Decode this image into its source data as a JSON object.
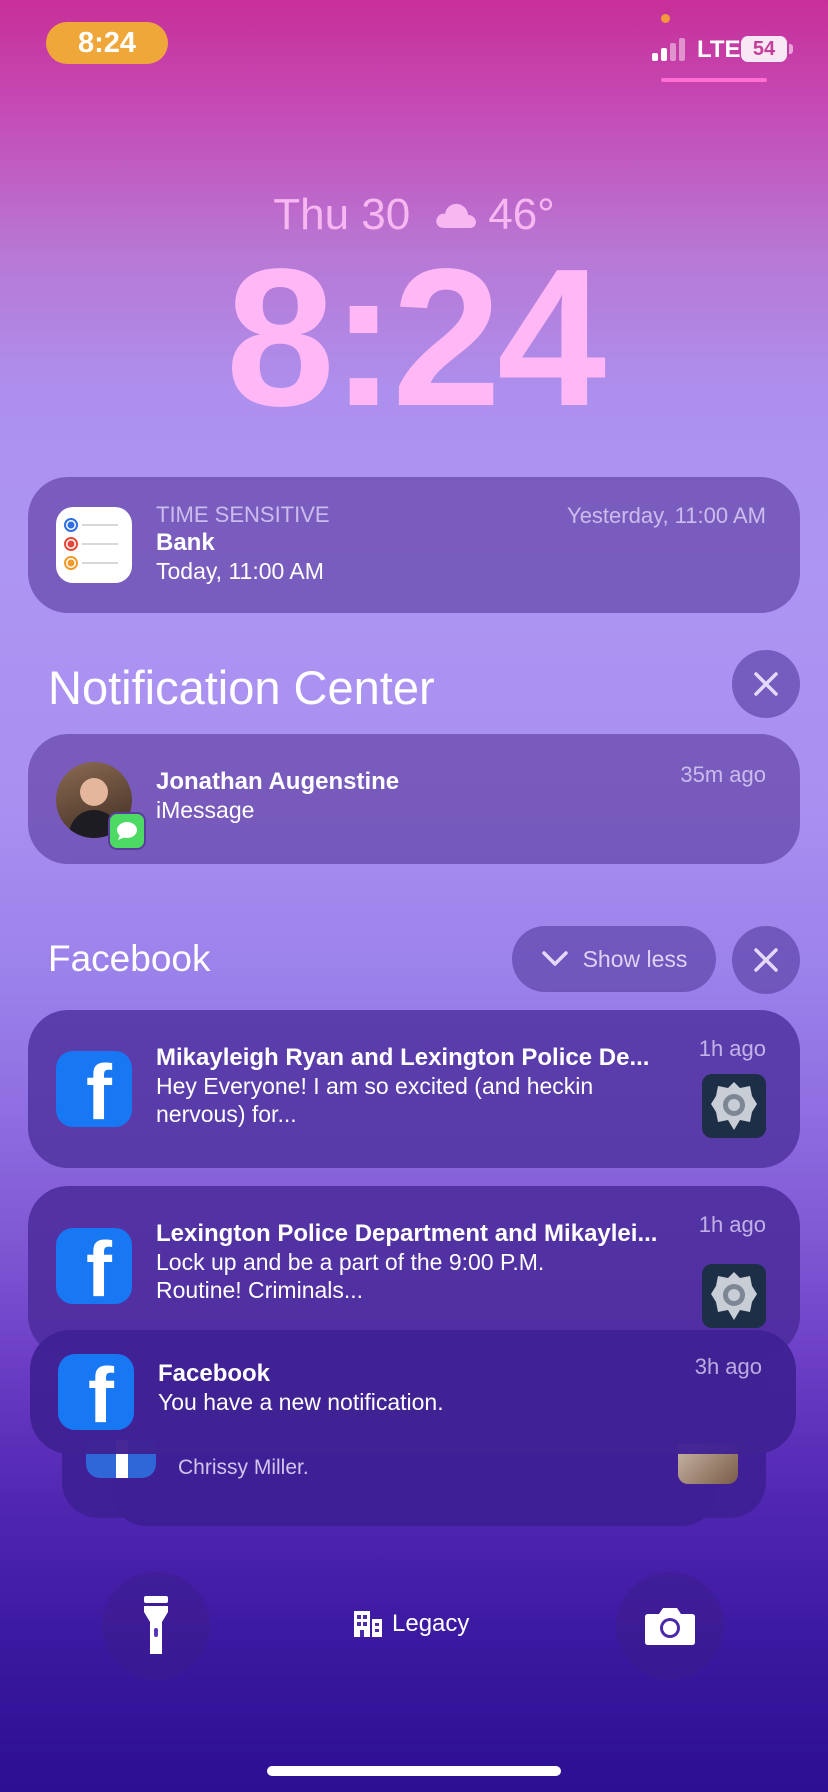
{
  "status_bar": {
    "time": "8:24",
    "carrier": "LTE",
    "battery": "54"
  },
  "lock_screen": {
    "date": "Thu 30",
    "weather_icon": "cloud-icon",
    "temperature": "46°",
    "clock": "8:24"
  },
  "time_sensitive": {
    "app_icon": "reminders-icon",
    "label": "TIME SENSITIVE",
    "title": "Bank",
    "body": "Today, 11:00 AM",
    "time": "Yesterday, 11:00 AM"
  },
  "notification_center": {
    "title": "Notification Center"
  },
  "imessage": {
    "sender": "Jonathan Augenstine",
    "app": "iMessage",
    "time": "35m ago"
  },
  "facebook_group": {
    "title": "Facebook",
    "show_less": "Show less",
    "notifications": [
      {
        "title": "Mikayleigh Ryan and Lexington Police De...",
        "body_line1": "Hey Everyone! I am so excited (and heckin",
        "body_line2": "nervous) for...",
        "time": "1h ago"
      },
      {
        "title": "Lexington Police Department and Mikaylei...",
        "body_line1": "Lock up and be a part of the 9:00 P.M.",
        "body_line2": "Routine! Criminals...",
        "time": "1h ago"
      },
      {
        "title": "Facebook",
        "body_line1": "You have a new notification.",
        "time": "3h ago"
      }
    ],
    "stacked_peek_text": "Chrissy Miller."
  },
  "bottom_controls": {
    "flashlight_icon": "flashlight-icon",
    "focus_label": "Legacy",
    "camera_icon": "camera-icon"
  },
  "colors": {
    "time_pill": "#f0a73a",
    "clock": "#ffb8f5",
    "facebook_blue": "#1877f2"
  }
}
